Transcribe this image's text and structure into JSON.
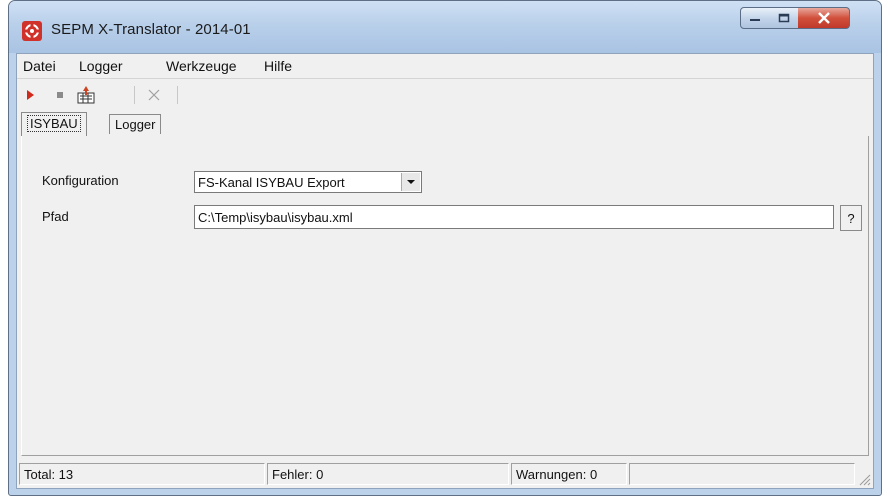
{
  "window": {
    "title": "SEPM X-Translator - 2014-01",
    "caption_buttons": [
      "minimize",
      "maximize",
      "close"
    ]
  },
  "menubar": {
    "items": [
      {
        "label": "Datei"
      },
      {
        "label": "Logger"
      },
      {
        "label": "Werkzeuge"
      },
      {
        "label": "Hilfe"
      }
    ]
  },
  "toolbar": {
    "buttons": [
      "play-icon",
      "stop-icon",
      "translate-icon",
      "cancel-icon"
    ]
  },
  "tabs": [
    {
      "label": "ISYBAU",
      "active": true
    },
    {
      "label": "Logger",
      "active": false
    }
  ],
  "form": {
    "konfiguration_label": "Konfiguration",
    "konfiguration_value": "FS-Kanal ISYBAU Export",
    "pfad_label": "Pfad",
    "pfad_value": "C:\\Temp\\isybau\\isybau.xml",
    "help_label": "?"
  },
  "statusbar": {
    "total": "Total: 13",
    "fehler": "Fehler: 0",
    "warnungen": "Warnungen: 0",
    "extra": ""
  },
  "colors": {
    "titlebar": "#b9d0ea",
    "close_button": "#c0392b",
    "play": "#d02a1c",
    "panel": "#f0f0f0"
  }
}
